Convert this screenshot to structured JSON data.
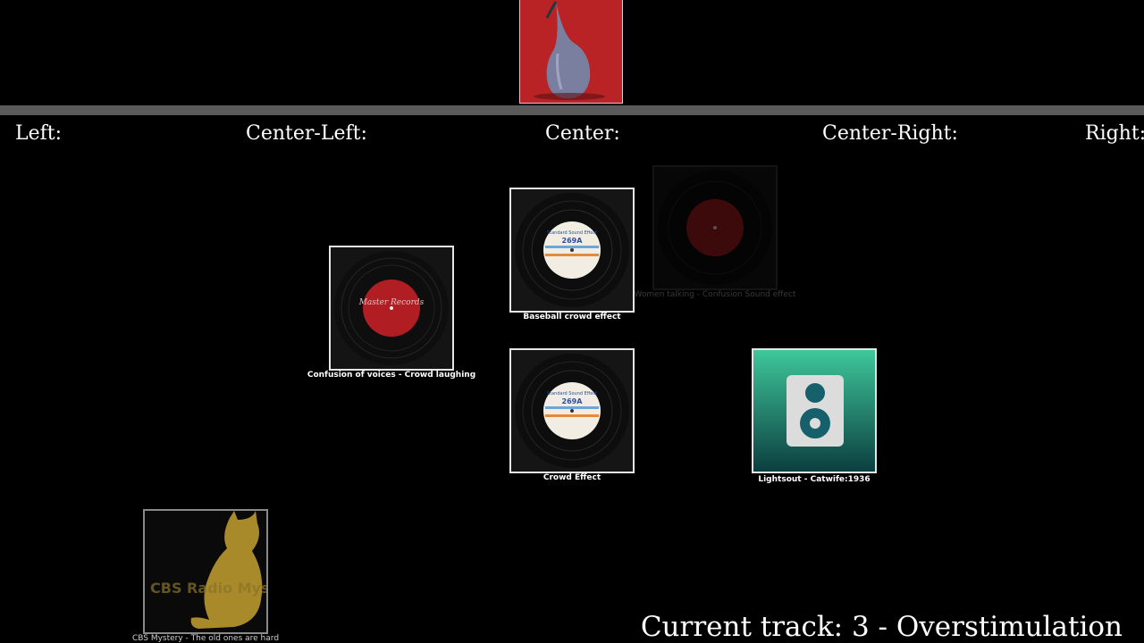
{
  "positions": {
    "left": "Left:",
    "center_left": "Center-Left:",
    "center": "Center:",
    "center_right": "Center-Right:",
    "right": "Right:"
  },
  "tracks": {
    "confusion_voices": "Confusion of voices - Crowd laughing",
    "baseball_crowd": "Baseball crowd effect",
    "women_talking": "Women talking - Confusion Sound effect",
    "crowd_effect": "Crowd Effect",
    "lightsout": "Lightsout - Catwife:1936",
    "cbs_mystery": "CBS Mystery - The old ones are hard"
  },
  "record_labels": {
    "master": "Master Records",
    "standard_title": "Standard Sound Effect",
    "standard_number": "269A",
    "cbs_text": "CBS Radio Mystery"
  },
  "current_track": {
    "text": "Current track: 3 - Overstimulation"
  },
  "colors": {
    "background": "#000000",
    "divider": "#5a5a5a",
    "master_label": "#b01d22",
    "speaker_top": "#3ec79a",
    "speaker_bottom": "#0c3f40",
    "cat": "#a88a2a"
  }
}
